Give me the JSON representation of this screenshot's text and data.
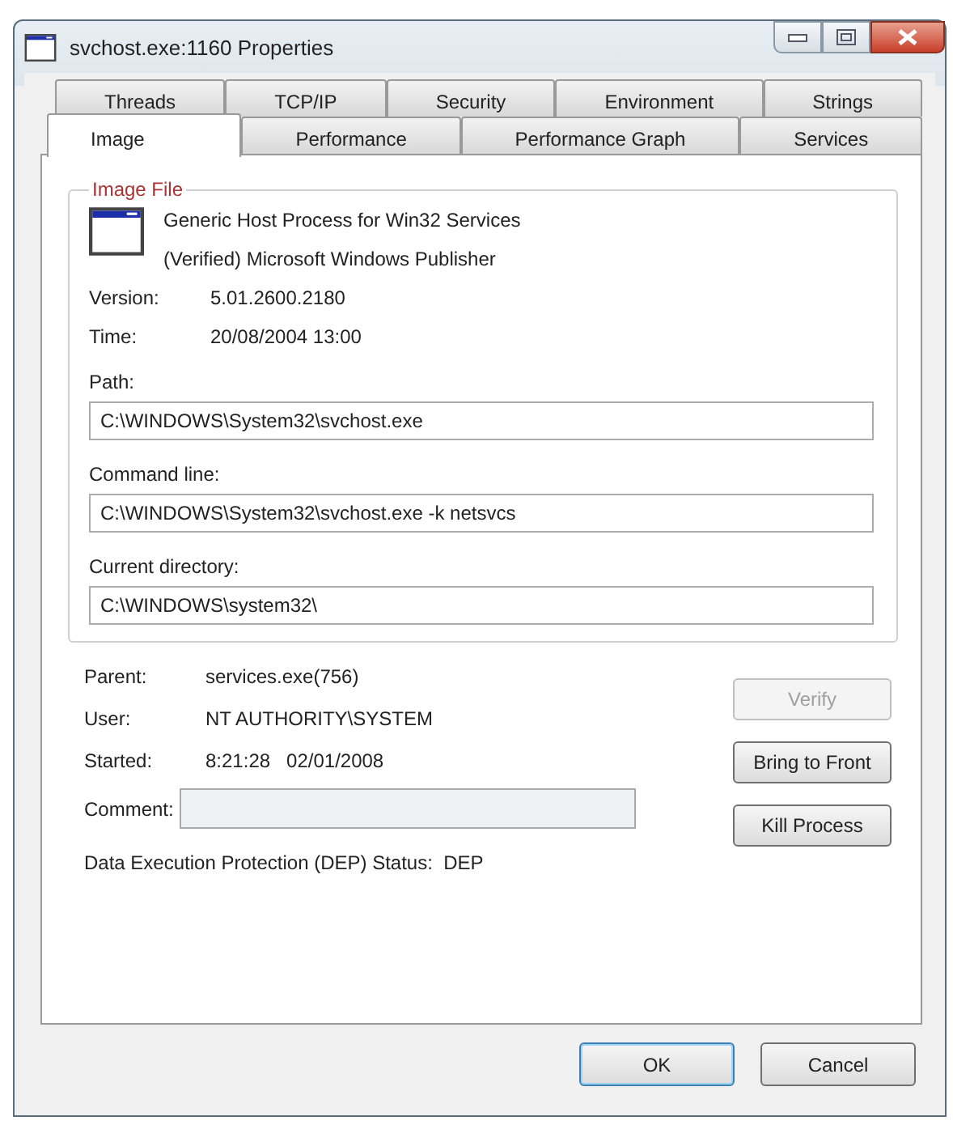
{
  "window": {
    "title": "svchost.exe:1160 Properties"
  },
  "tab_rows": [
    {
      "tabs": [
        {
          "label": "Threads",
          "selected": false
        },
        {
          "label": "TCP/IP",
          "selected": false
        },
        {
          "label": "Security",
          "selected": false
        },
        {
          "label": "Environment",
          "selected": false
        },
        {
          "label": "Strings",
          "selected": false
        }
      ]
    },
    {
      "tabs": [
        {
          "label": "Image",
          "selected": true
        },
        {
          "label": "Performance",
          "selected": false
        },
        {
          "label": "Performance Graph",
          "selected": false
        },
        {
          "label": "Services",
          "selected": false
        }
      ]
    }
  ],
  "image_file": {
    "title": "Image File",
    "description": "Generic Host Process for Win32 Services",
    "company": "(Verified) Microsoft Windows Publisher",
    "info": [
      {
        "label": "Version:",
        "value": "5.01.2600.2180"
      },
      {
        "label": "Time:",
        "value": "20/08/2004 13:00"
      }
    ],
    "fields": [
      {
        "label": "Path:",
        "value": "C:\\WINDOWS\\System32\\svchost.exe"
      },
      {
        "label": "Command line:",
        "value": "C:\\WINDOWS\\System32\\svchost.exe -k netsvcs"
      },
      {
        "label": "Current directory:",
        "value": "C:\\WINDOWS\\system32\\"
      }
    ]
  },
  "process": {
    "info": [
      {
        "label": "Parent:",
        "value": "services.exe(756)"
      },
      {
        "label": "User:",
        "value": "NT AUTHORITY\\SYSTEM"
      },
      {
        "label": "Started:",
        "value": "8:21:28   02/01/2008"
      }
    ],
    "comment": {
      "label": "Comment:"
    },
    "dep": {
      "label": "Data Execution Protection (DEP) Status:",
      "value": "DEP"
    },
    "buttons": [
      {
        "label": "Verify",
        "disabled": true
      },
      {
        "label": "Bring to Front",
        "disabled": false
      },
      {
        "label": "Kill Process",
        "disabled": false
      }
    ]
  },
  "dialog_buttons": [
    {
      "label": "OK",
      "default": true
    },
    {
      "label": "Cancel",
      "default": false
    }
  ]
}
